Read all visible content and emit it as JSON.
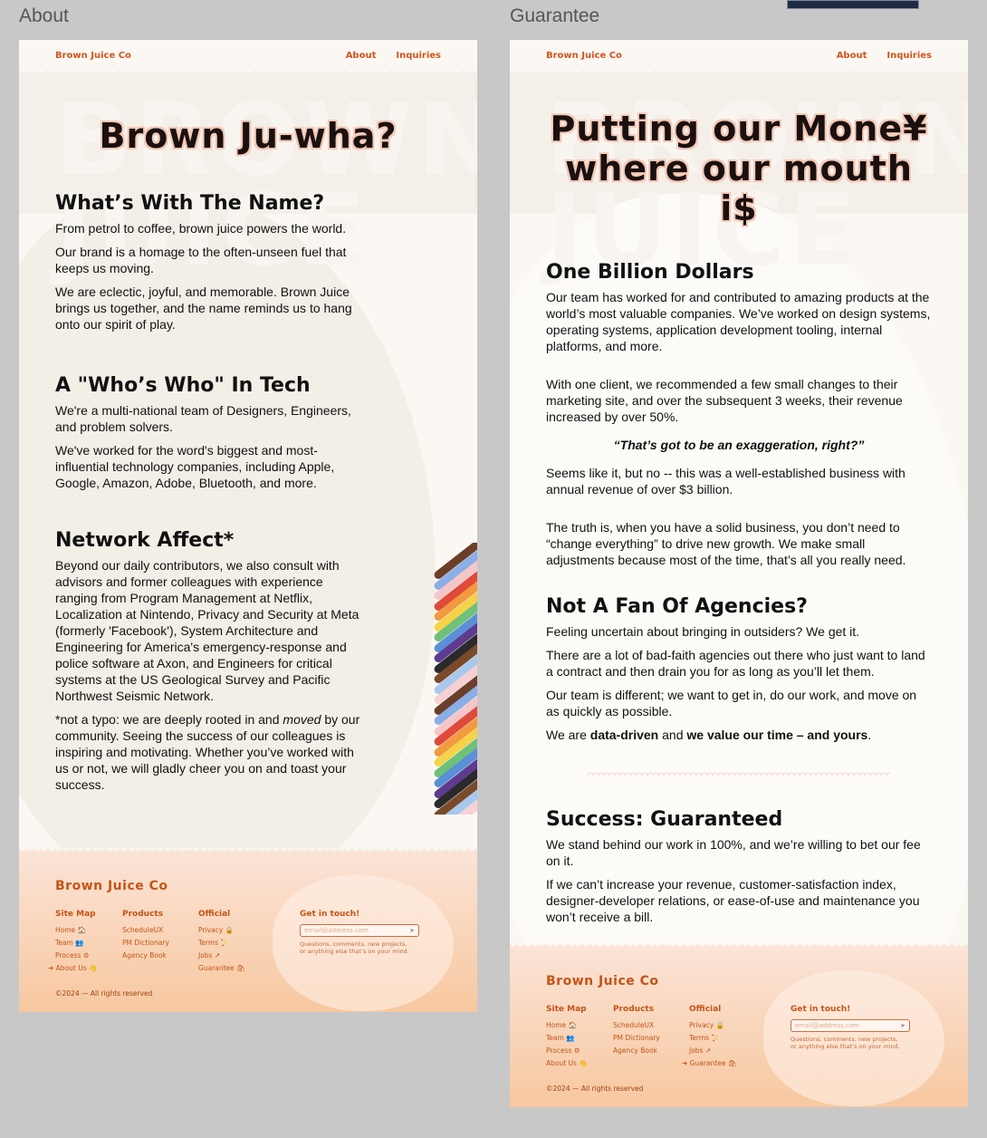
{
  "frames": [
    {
      "label": "About",
      "nav": {
        "brand": "Brown Juice Co",
        "links": [
          "About",
          "Inquiries"
        ]
      },
      "title": "Brown Ju-wha?",
      "ghost_text": "BROWN JUICE",
      "sections": [
        {
          "heading": "What’s With The Name?",
          "paragraphs": [
            "From petrol to coffee, brown juice powers the world.",
            "Our brand is a homage to the often-unseen fuel that keeps us moving.",
            "We are eclectic, joyful, and memorable. Brown Juice brings us together, and the name reminds us to hang onto our spirit of play."
          ]
        },
        {
          "heading": "A \"Who’s Who\" In Tech",
          "paragraphs": [
            "We're a multi-national team of Designers, Engineers, and problem solvers.",
            "We've worked for the word's biggest and most-influential technology companies, including Apple, Google, Amazon, Adobe, Bluetooth, and more."
          ]
        },
        {
          "heading": "Network Affect*",
          "paragraphs": [
            "Beyond our daily contributors, we also consult with advisors and former colleagues with experience ranging from Program Management at Netflix, Localization at Nintendo, Privacy and Security at Meta (formerly 'Facebook'), System Architecture and Engineering for America's emergency-response and police software at Axon, and Engineers for critical systems at the US Geological Survey and Pacific Northwest Seismic Network."
          ],
          "footnote": {
            "before": "*not a typo: we are deeply rooted in and ",
            "em": "moved",
            "after": " by our community. Seeing the success of our colleagues is inspiring and motivating. Whether you’ve worked with us or not, we will gladly cheer you on and toast your success."
          }
        }
      ]
    },
    {
      "label": "Guarantee",
      "nav": {
        "brand": "Brown Juice Co",
        "links": [
          "About",
          "Inquiries"
        ]
      },
      "title_line1": "Putting our Mone¥",
      "title_line2": "where our mouth i$",
      "ghost_text": "BROWN JUICE",
      "billion": {
        "heading": "One Billion Dollars",
        "p1": "Our team has worked for and contributed to amazing products at the world’s most valuable companies. We’ve worked on design systems, operating systems, application development tooling, internal platforms, and more.",
        "p2": "With one client, we recommended a few small changes to their marketing site, and over the subsequent 3 weeks, their revenue increased by over 50%.",
        "quote": "“That’s got to be an exaggeration, right?”",
        "p3": "Seems like it, but no -- this was a well-established business with annual revenue of over $3 billion.",
        "p4": "The truth is, when you have a solid business, you don’t need to “change everything” to drive new growth. We make small adjustments because most of the time, that’s all you really need."
      },
      "agencies": {
        "heading": "Not A Fan Of Agencies?",
        "p1": "Feeling uncertain about bringing in outsiders? We get it.",
        "p2": "There are a lot of bad-faith agencies out there who just want to land a contract and then drain you for as long as you’ll let them.",
        "p3": "Our team is different; we want to get in, do our work, and move on as quickly as possible.",
        "p4_a": "We are ",
        "p4_b": "data-driven",
        "p4_c": " and ",
        "p4_d": "we value our time – and yours",
        "p4_e": "."
      },
      "success": {
        "heading": "Success: Guaranteed",
        "p1": "We stand behind our work in 100%, and we’re willing to bet our fee on it.",
        "p2": "If we can’t increase your revenue, customer-satisfaction index, designer-developer relations, or ease-of-use and maintenance you won’t receive a bill."
      }
    }
  ],
  "footer": {
    "brand": "Brown Juice Co",
    "sitemap": {
      "heading": "Site Map",
      "items": [
        "Home 🏠",
        "Team 👥",
        "Process ⚙",
        "About Us 👋"
      ]
    },
    "products": {
      "heading": "Products",
      "items": [
        "ScheduleUX",
        "PM Dictionary",
        "Agency Book"
      ]
    },
    "official": {
      "heading": "Official",
      "items": [
        "Privacy 🔒",
        "Terms 📜",
        "Jobs ↗",
        "Guarantee 🛍"
      ]
    },
    "touch": {
      "heading": "Get in touch!",
      "placeholder": "email@address.com",
      "note1": "Questions, comments, new projects,",
      "note2": "or anything else that’s on your mind."
    },
    "copyright": "©2024 — All rights reserved"
  },
  "rainbow_colors": [
    "#6b3e2a",
    "#8aaee6",
    "#f5c6c8",
    "#e04a3a",
    "#f29a40",
    "#f5d24a",
    "#6ec07a",
    "#5b8fd6",
    "#5e3b8e",
    "#2a2a2a",
    "#7a4a2a",
    "#a8c8ee",
    "#f7d0d4"
  ]
}
